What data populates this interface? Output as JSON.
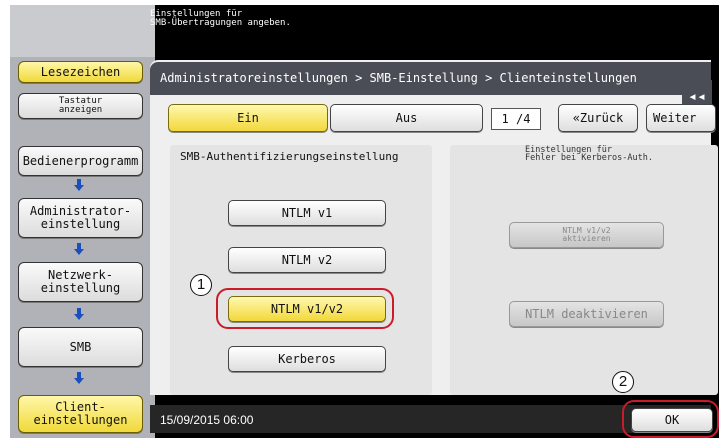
{
  "header": {
    "message": "Einstellungen für\nSMB-Übertragungen angeben."
  },
  "sidebar": {
    "bookmark_label": "Lesezeichen",
    "keyboard_label": "Tastatur\nanzeigen",
    "flow": [
      {
        "label": "Bedienerprogramm"
      },
      {
        "label": "Administrator-\neinstellung"
      },
      {
        "label": "Netzwerk-\neinstellung"
      },
      {
        "label": "SMB"
      },
      {
        "label": "Client-\neinstellungen"
      }
    ]
  },
  "breadcrumb": {
    "text": "Administratoreinstellungen > SMB-Einstellung > Clienteinstellungen"
  },
  "toggle": {
    "on_label": "Ein",
    "off_label": "Aus",
    "selected": "Ein"
  },
  "pagination": {
    "page": "1 /4",
    "back_label": "«Zurück",
    "next_label": "Weiter"
  },
  "tab_toggle_icon": "double-chevron-left-icon",
  "auth_section": {
    "title": "SMB-Authentifizierungseinstellung",
    "options": [
      "NTLM v1",
      "NTLM v2",
      "NTLM v1/v2",
      "Kerberos"
    ],
    "selected": "NTLM v1/v2"
  },
  "fallback_section": {
    "title": "Einstellungen für\nFehler bei Kerberos-Auth.",
    "enable_label": "NTLM v1/v2\naktivieren",
    "disable_label": "NTLM deaktivieren"
  },
  "annotations": {
    "step1": "1",
    "step2": "2",
    "highlight_color": "#cc1a2a"
  },
  "footer": {
    "datetime": "15/09/2015  06:00",
    "ok_label": "OK"
  }
}
